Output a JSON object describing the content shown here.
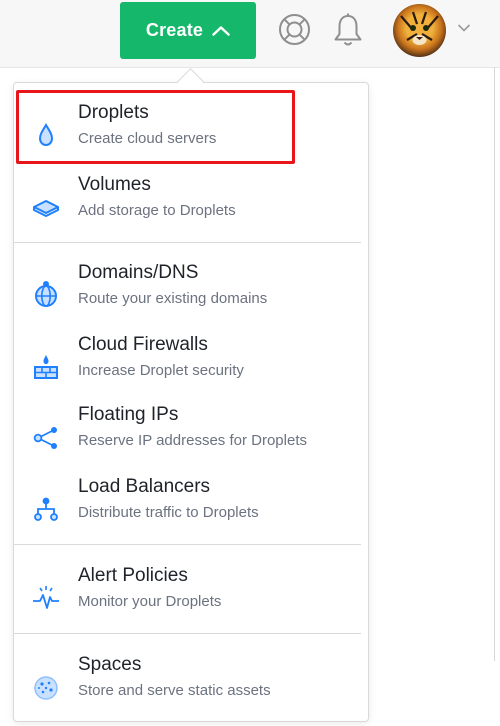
{
  "header": {
    "create_label": "Create",
    "icons": [
      "chevron-up-icon",
      "help-lifebuoy-icon",
      "notification-bell-icon",
      "user-avatar",
      "chevron-down-icon"
    ]
  },
  "colors": {
    "create_green": "#15b86b",
    "icon_blue": "#1f80ff",
    "highlight_red": "#e8161b"
  },
  "menu": {
    "items": [
      {
        "icon": "droplet-icon",
        "title": "Droplets",
        "subtitle": "Create cloud servers",
        "highlighted": true
      },
      {
        "icon": "volume-icon",
        "title": "Volumes",
        "subtitle": "Add storage to Droplets"
      },
      {
        "icon": "globe-icon",
        "title": "Domains/DNS",
        "subtitle": "Route your existing domains"
      },
      {
        "icon": "firewall-icon",
        "title": "Cloud Firewalls",
        "subtitle": "Increase Droplet security"
      },
      {
        "icon": "floating-ip-icon",
        "title": "Floating IPs",
        "subtitle": "Reserve IP addresses for Droplets"
      },
      {
        "icon": "load-balancer-icon",
        "title": "Load Balancers",
        "subtitle": "Distribute traffic to Droplets"
      },
      {
        "icon": "alert-policy-icon",
        "title": "Alert Policies",
        "subtitle": "Monitor your Droplets"
      },
      {
        "icon": "spaces-icon",
        "title": "Spaces",
        "subtitle": "Store and serve static assets"
      }
    ]
  }
}
